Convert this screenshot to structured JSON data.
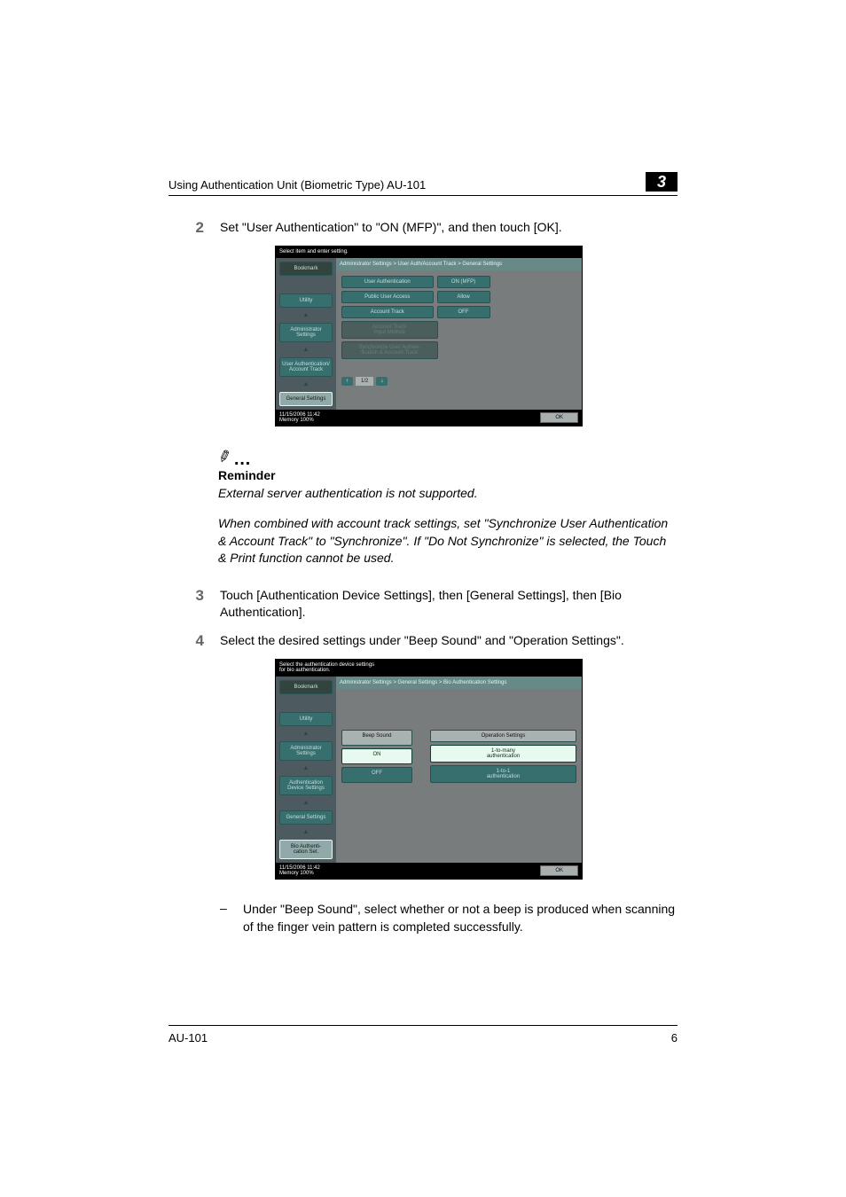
{
  "header": {
    "title": "Using Authentication Unit (Biometric Type) AU-101",
    "chapter": "3"
  },
  "steps": {
    "s2": {
      "num": "2",
      "text": "Set \"User Authentication\" to \"ON (MFP)\", and then touch [OK]."
    },
    "s3": {
      "num": "3",
      "text": "Touch [Authentication Device Settings], then [General Settings], then [Bio Authentication]."
    },
    "s4": {
      "num": "4",
      "text": "Select the desired settings under \"Beep Sound\" and \"Operation Settings\"."
    }
  },
  "fig1": {
    "top": "Select item and enter setting.",
    "side": {
      "bookmark": "Bookmark",
      "utility": "Utility",
      "admin": "Administrator Settings",
      "auth": "User Authentication/\nAccount Track",
      "gen": "General Settings"
    },
    "crumb": "Administrator Settings > User Auth/Account Track  > General Settings",
    "rows": {
      "r1l": "User Authentication",
      "r1r": "ON (MFP)",
      "r2l": "Public User Access",
      "r2r": "Allow",
      "r3l": "Account Track",
      "r3r": "OFF",
      "r4l": "Account Track\nInput Method",
      "r5l": "Synchronize User Authen-\ntication & Account Track"
    },
    "pager": {
      "up": "↑",
      "page": "1/2",
      "down": "↓"
    },
    "foot": {
      "date": "11/15/2006   11:42",
      "mem": "Memory        100%",
      "ok": "OK"
    }
  },
  "reminder": {
    "label": "Reminder",
    "p1": "External server authentication is not supported.",
    "p2": "When combined with account track settings, set \"Synchronize User Authentication & Account Track\" to \"Synchronize\". If \"Do Not Synchronize\" is selected, the Touch & Print function cannot be used."
  },
  "fig2": {
    "top": "Select the authentication device settings\nfor bio authentication.",
    "side": {
      "bookmark": "Bookmark",
      "utility": "Utility",
      "admin": "Administrator Settings",
      "authdev": "Authentication\nDevice Settings",
      "gen": "General Settings",
      "bio": "Bio Authenti-\ncation Set."
    },
    "crumb": "Administrator Settings > General Settings > Bio Authentication Settings",
    "beep": {
      "label": "Beep Sound",
      "on": "ON",
      "off": "OFF"
    },
    "op": {
      "label": "Operation Settings",
      "a": "1-to-many\nauthentication",
      "b": "1-to-1\nauthentication"
    },
    "foot": {
      "date": "11/15/2006   11:42",
      "mem": "Memory        100%",
      "ok": "OK"
    }
  },
  "bullet": {
    "dash": "–",
    "text": "Under \"Beep Sound\", select whether or not a beep is produced when scanning of the finger vein pattern is completed successfully."
  },
  "footer": {
    "left": "AU-101",
    "right": "6"
  }
}
